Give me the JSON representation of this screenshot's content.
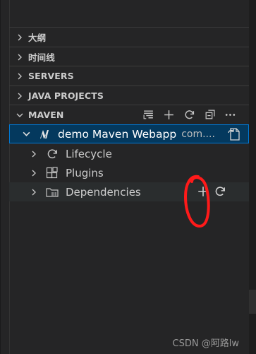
{
  "sections": [
    {
      "label": "大纲"
    },
    {
      "label": "时间线"
    },
    {
      "label": "SERVERS"
    },
    {
      "label": "JAVA PROJECTS"
    },
    {
      "label": "MAVEN"
    }
  ],
  "maven_actions": [
    "list-filter-icon",
    "plus-icon",
    "refresh-icon",
    "collapse-all-icon",
    "more-icon"
  ],
  "project": {
    "name": "demo Maven Webapp",
    "suffix": "com...."
  },
  "children": [
    {
      "label": "Lifecycle",
      "icon": "refresh-icon"
    },
    {
      "label": "Plugins",
      "icon": "extensions-icon"
    },
    {
      "label": "Dependencies",
      "icon": "folder-library-icon"
    }
  ],
  "watermark": "CSDN @阿路lw",
  "colors": {
    "selection": "#04395e",
    "focus_border": "#0078d4",
    "annotation": "#ff0000"
  }
}
